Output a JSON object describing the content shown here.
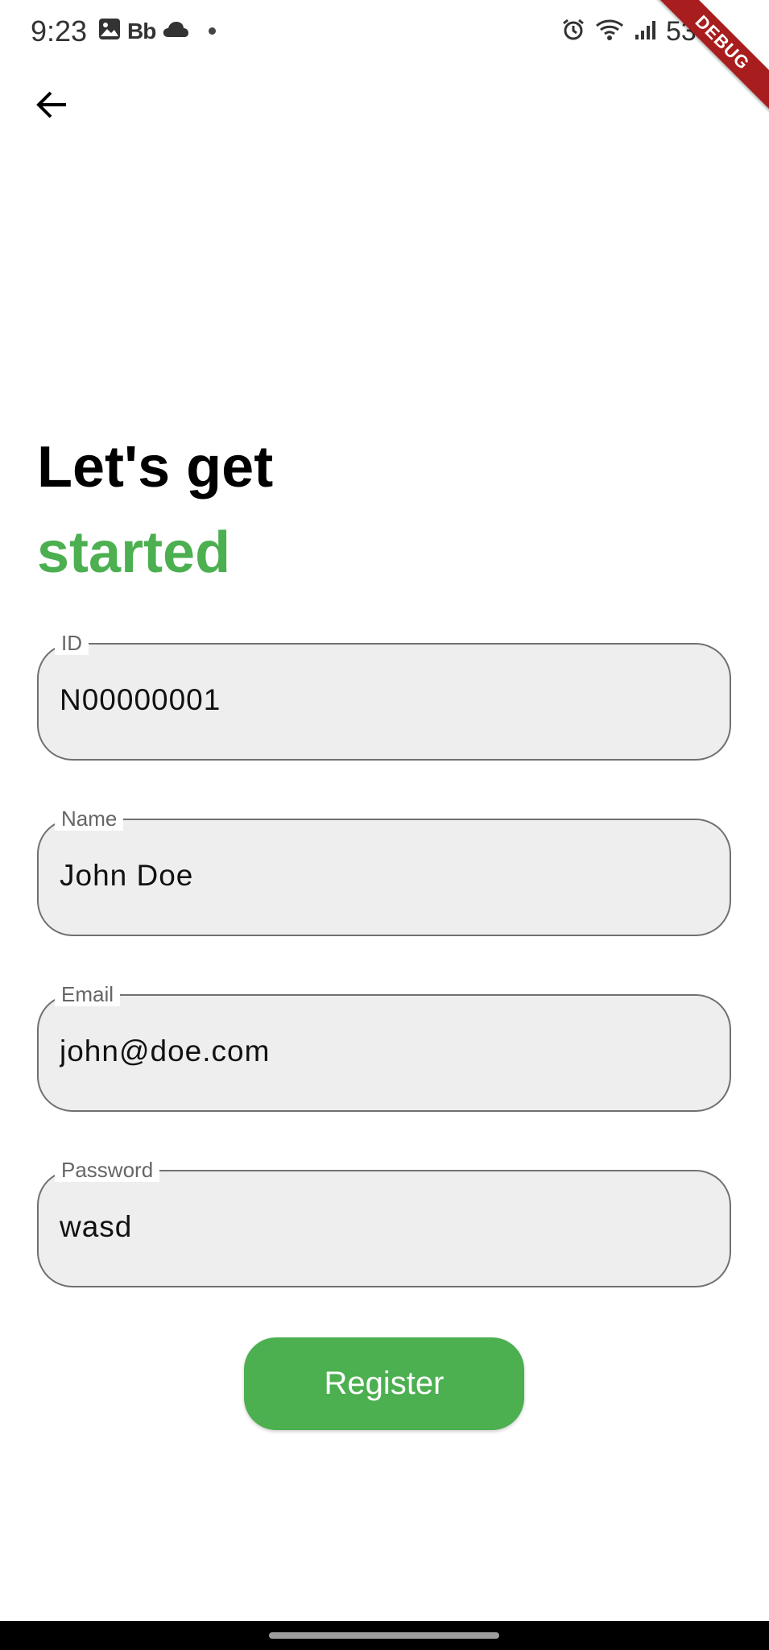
{
  "status_bar": {
    "time": "9:23",
    "bb_label": "Bb",
    "battery_text": "53%",
    "icons": [
      "image-icon",
      "cloud-icon",
      "alarm-icon",
      "wifi-icon",
      "signal-icon",
      "battery-icon"
    ]
  },
  "debug_banner": {
    "label": "DEBUG",
    "color": "#a81d1d"
  },
  "header": {
    "back_icon": "arrow-left-icon"
  },
  "heading": {
    "line1": "Let's get",
    "line2": "started",
    "accent_color": "#4caf50"
  },
  "form": {
    "id": {
      "label": "ID",
      "value": "N00000001"
    },
    "name": {
      "label": "Name",
      "value": "John Doe"
    },
    "email": {
      "label": "Email",
      "value": "john@doe.com"
    },
    "password": {
      "label": "Password",
      "value": "wasd"
    }
  },
  "register_button": {
    "label": "Register",
    "color": "#4caf50"
  }
}
